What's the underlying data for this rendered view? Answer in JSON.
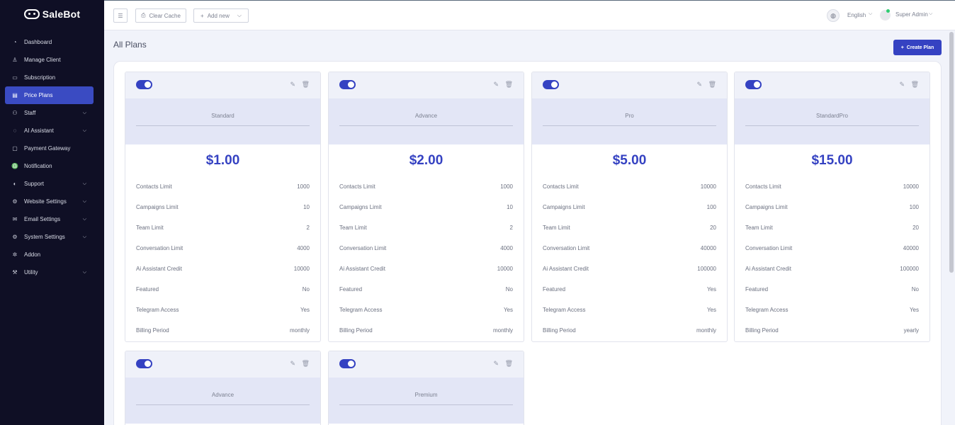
{
  "brand": {
    "name": "SaleBot"
  },
  "sidebar": {
    "items": [
      {
        "label": "Dashboard",
        "icon": "dashboard-icon",
        "glyph": "◔",
        "chevron": false,
        "active": false
      },
      {
        "label": "Manage Client",
        "icon": "user-icon",
        "glyph": "♙",
        "chevron": false,
        "active": false
      },
      {
        "label": "Subscription",
        "icon": "card-icon",
        "glyph": "▭",
        "chevron": false,
        "active": false
      },
      {
        "label": "Price Plans",
        "icon": "price-tag-icon",
        "glyph": "▤",
        "chevron": false,
        "active": true
      },
      {
        "label": "Staff",
        "icon": "users-icon",
        "glyph": "⚇",
        "chevron": true,
        "active": false
      },
      {
        "label": "AI Assistant",
        "icon": "chat-icon",
        "glyph": "◌",
        "chevron": true,
        "active": false
      },
      {
        "label": "Payment Gateway",
        "icon": "wallet-icon",
        "glyph": "▢",
        "chevron": false,
        "active": false
      },
      {
        "label": "Notification",
        "icon": "bell-icon",
        "glyph": "♎",
        "chevron": false,
        "active": false
      },
      {
        "label": "Support",
        "icon": "headset-icon",
        "glyph": "◐",
        "chevron": true,
        "active": false
      },
      {
        "label": "Website Settings",
        "icon": "gear-icon",
        "glyph": "⚙",
        "chevron": true,
        "active": false
      },
      {
        "label": "Email Settings",
        "icon": "mail-icon",
        "glyph": "✉",
        "chevron": true,
        "active": false
      },
      {
        "label": "System Settings",
        "icon": "gear-icon",
        "glyph": "⚙",
        "chevron": true,
        "active": false
      },
      {
        "label": "Addon",
        "icon": "puzzle-icon",
        "glyph": "✲",
        "chevron": false,
        "active": false
      },
      {
        "label": "Utility",
        "icon": "tools-icon",
        "glyph": "⚒",
        "chevron": true,
        "active": false
      }
    ]
  },
  "header": {
    "clear_cache": "Clear Cache",
    "add_new": "Add new",
    "language": "English",
    "user": "Super Admin"
  },
  "page": {
    "title": "All Plans",
    "create_button": "Create Plan"
  },
  "row_labels": [
    "Contacts Limit",
    "Campaigns Limit",
    "Team Limit",
    "Conversation Limit",
    "Ai Assistant Credit",
    "Featured",
    "Telegram Access",
    "Billing Period"
  ],
  "plans": [
    {
      "name": "Standard",
      "price": "$1.00",
      "enabled": true,
      "values": [
        "1000",
        "10",
        "2",
        "4000",
        "10000",
        "No",
        "Yes",
        "monthly"
      ]
    },
    {
      "name": "Advance",
      "price": "$2.00",
      "enabled": true,
      "values": [
        "1000",
        "10",
        "2",
        "4000",
        "10000",
        "No",
        "Yes",
        "monthly"
      ]
    },
    {
      "name": "Pro",
      "price": "$5.00",
      "enabled": true,
      "values": [
        "10000",
        "100",
        "20",
        "40000",
        "100000",
        "Yes",
        "Yes",
        "monthly"
      ]
    },
    {
      "name": "StandardPro",
      "price": "$15.00",
      "enabled": true,
      "values": [
        "10000",
        "100",
        "20",
        "40000",
        "100000",
        "No",
        "Yes",
        "yearly"
      ]
    },
    {
      "name": "Advance",
      "price": "",
      "enabled": true,
      "values": []
    },
    {
      "name": "Premium",
      "price": "",
      "enabled": true,
      "values": []
    }
  ],
  "colors": {
    "accent": "#3542c2",
    "sidebar_bg": "#0f0f25"
  }
}
